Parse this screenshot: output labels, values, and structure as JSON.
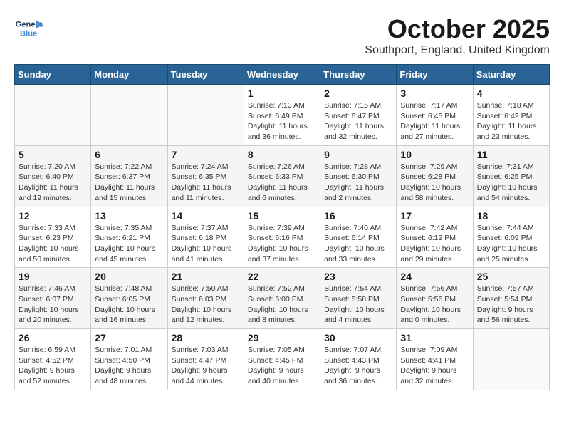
{
  "logo": {
    "line1": "General",
    "line2": "Blue"
  },
  "title": "October 2025",
  "location": "Southport, England, United Kingdom",
  "weekdays": [
    "Sunday",
    "Monday",
    "Tuesday",
    "Wednesday",
    "Thursday",
    "Friday",
    "Saturday"
  ],
  "weeks": [
    [
      {
        "day": "",
        "info": ""
      },
      {
        "day": "",
        "info": ""
      },
      {
        "day": "",
        "info": ""
      },
      {
        "day": "1",
        "info": "Sunrise: 7:13 AM\nSunset: 6:49 PM\nDaylight: 11 hours\nand 36 minutes."
      },
      {
        "day": "2",
        "info": "Sunrise: 7:15 AM\nSunset: 6:47 PM\nDaylight: 11 hours\nand 32 minutes."
      },
      {
        "day": "3",
        "info": "Sunrise: 7:17 AM\nSunset: 6:45 PM\nDaylight: 11 hours\nand 27 minutes."
      },
      {
        "day": "4",
        "info": "Sunrise: 7:18 AM\nSunset: 6:42 PM\nDaylight: 11 hours\nand 23 minutes."
      }
    ],
    [
      {
        "day": "5",
        "info": "Sunrise: 7:20 AM\nSunset: 6:40 PM\nDaylight: 11 hours\nand 19 minutes."
      },
      {
        "day": "6",
        "info": "Sunrise: 7:22 AM\nSunset: 6:37 PM\nDaylight: 11 hours\nand 15 minutes."
      },
      {
        "day": "7",
        "info": "Sunrise: 7:24 AM\nSunset: 6:35 PM\nDaylight: 11 hours\nand 11 minutes."
      },
      {
        "day": "8",
        "info": "Sunrise: 7:26 AM\nSunset: 6:33 PM\nDaylight: 11 hours\nand 6 minutes."
      },
      {
        "day": "9",
        "info": "Sunrise: 7:28 AM\nSunset: 6:30 PM\nDaylight: 11 hours\nand 2 minutes."
      },
      {
        "day": "10",
        "info": "Sunrise: 7:29 AM\nSunset: 6:28 PM\nDaylight: 10 hours\nand 58 minutes."
      },
      {
        "day": "11",
        "info": "Sunrise: 7:31 AM\nSunset: 6:25 PM\nDaylight: 10 hours\nand 54 minutes."
      }
    ],
    [
      {
        "day": "12",
        "info": "Sunrise: 7:33 AM\nSunset: 6:23 PM\nDaylight: 10 hours\nand 50 minutes."
      },
      {
        "day": "13",
        "info": "Sunrise: 7:35 AM\nSunset: 6:21 PM\nDaylight: 10 hours\nand 45 minutes."
      },
      {
        "day": "14",
        "info": "Sunrise: 7:37 AM\nSunset: 6:18 PM\nDaylight: 10 hours\nand 41 minutes."
      },
      {
        "day": "15",
        "info": "Sunrise: 7:39 AM\nSunset: 6:16 PM\nDaylight: 10 hours\nand 37 minutes."
      },
      {
        "day": "16",
        "info": "Sunrise: 7:40 AM\nSunset: 6:14 PM\nDaylight: 10 hours\nand 33 minutes."
      },
      {
        "day": "17",
        "info": "Sunrise: 7:42 AM\nSunset: 6:12 PM\nDaylight: 10 hours\nand 29 minutes."
      },
      {
        "day": "18",
        "info": "Sunrise: 7:44 AM\nSunset: 6:09 PM\nDaylight: 10 hours\nand 25 minutes."
      }
    ],
    [
      {
        "day": "19",
        "info": "Sunrise: 7:46 AM\nSunset: 6:07 PM\nDaylight: 10 hours\nand 20 minutes."
      },
      {
        "day": "20",
        "info": "Sunrise: 7:48 AM\nSunset: 6:05 PM\nDaylight: 10 hours\nand 16 minutes."
      },
      {
        "day": "21",
        "info": "Sunrise: 7:50 AM\nSunset: 6:03 PM\nDaylight: 10 hours\nand 12 minutes."
      },
      {
        "day": "22",
        "info": "Sunrise: 7:52 AM\nSunset: 6:00 PM\nDaylight: 10 hours\nand 8 minutes."
      },
      {
        "day": "23",
        "info": "Sunrise: 7:54 AM\nSunset: 5:58 PM\nDaylight: 10 hours\nand 4 minutes."
      },
      {
        "day": "24",
        "info": "Sunrise: 7:56 AM\nSunset: 5:56 PM\nDaylight: 10 hours\nand 0 minutes."
      },
      {
        "day": "25",
        "info": "Sunrise: 7:57 AM\nSunset: 5:54 PM\nDaylight: 9 hours\nand 56 minutes."
      }
    ],
    [
      {
        "day": "26",
        "info": "Sunrise: 6:59 AM\nSunset: 4:52 PM\nDaylight: 9 hours\nand 52 minutes."
      },
      {
        "day": "27",
        "info": "Sunrise: 7:01 AM\nSunset: 4:50 PM\nDaylight: 9 hours\nand 48 minutes."
      },
      {
        "day": "28",
        "info": "Sunrise: 7:03 AM\nSunset: 4:47 PM\nDaylight: 9 hours\nand 44 minutes."
      },
      {
        "day": "29",
        "info": "Sunrise: 7:05 AM\nSunset: 4:45 PM\nDaylight: 9 hours\nand 40 minutes."
      },
      {
        "day": "30",
        "info": "Sunrise: 7:07 AM\nSunset: 4:43 PM\nDaylight: 9 hours\nand 36 minutes."
      },
      {
        "day": "31",
        "info": "Sunrise: 7:09 AM\nSunset: 4:41 PM\nDaylight: 9 hours\nand 32 minutes."
      },
      {
        "day": "",
        "info": ""
      }
    ]
  ]
}
